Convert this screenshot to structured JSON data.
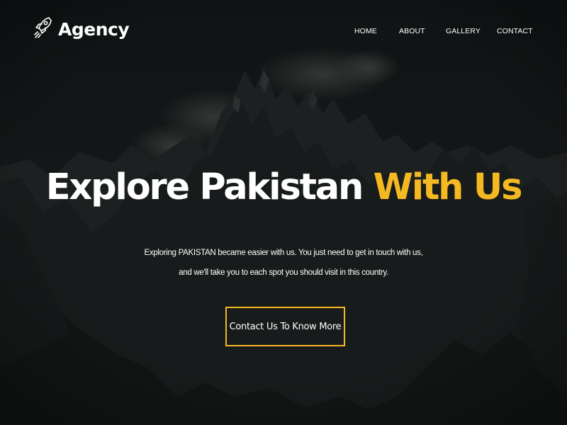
{
  "colors": {
    "accent": "#f4b822",
    "text": "#ffffff",
    "background": "#121414"
  },
  "brand": {
    "name": "Agency",
    "icon": "rocket-icon"
  },
  "nav": {
    "items": [
      {
        "label": "HOME"
      },
      {
        "label": "ABOUT"
      },
      {
        "label": "GALLERY"
      },
      {
        "label": "CONTACT"
      }
    ]
  },
  "hero": {
    "background": "dark-mountain-landscape",
    "headline_main": "Explore Pakistan ",
    "headline_accent": "With Us",
    "description_lines": [
      "Exploring PAKISTAN became easier with us. You just need to get in touch with us,",
      "and we'll take you to each spot you should visit in this country."
    ],
    "cta_label": "Contact Us To Know More"
  }
}
